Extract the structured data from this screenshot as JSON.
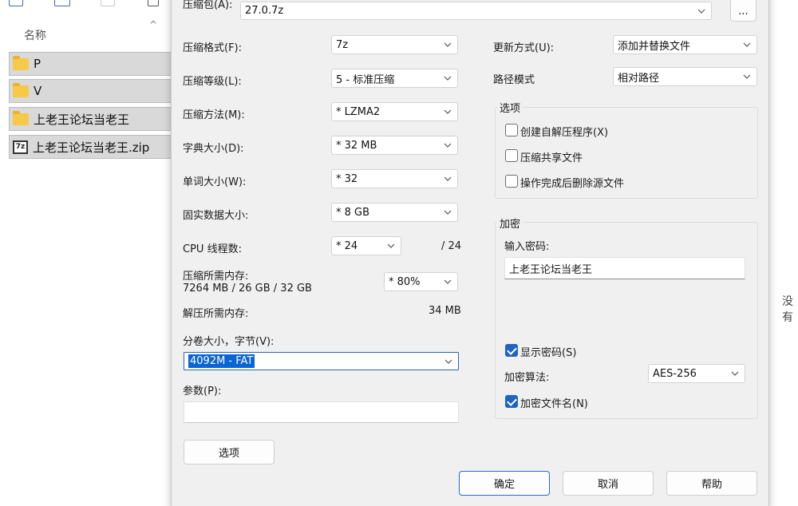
{
  "explorer": {
    "column_header": "名称",
    "items": [
      {
        "name": "P",
        "icon": "folder-icon"
      },
      {
        "name": "V",
        "icon": "folder-icon"
      },
      {
        "name": "上老王论坛当老王",
        "icon": "folder-icon"
      },
      {
        "name": "上老王论坛当老王.zip",
        "icon": "7z-archive-icon"
      }
    ],
    "right_text": "没有"
  },
  "dialog": {
    "archive_label": "压缩包(A):",
    "archive_value": "27.0.7z",
    "browse_label": "...",
    "format_label": "压缩格式(F):",
    "format_value": "7z",
    "level_label": "压缩等级(L):",
    "level_value": "5 - 标准压缩",
    "method_label": "压缩方法(M):",
    "method_value": "* LZMA2",
    "dict_label": "字典大小(D):",
    "dict_value": "* 32 MB",
    "word_label": "单词大小(W):",
    "word_value": "* 32",
    "solid_label": "固实数据大小:",
    "solid_value": "* 8 GB",
    "threads_label": "CPU 线程数:",
    "threads_value": "* 24",
    "threads_max": "/ 24",
    "mem_label": "压缩所需内存:",
    "mem_detail": "7264 MB / 26 GB / 32 GB",
    "mem_value": "* 80%",
    "decomp_label": "解压所需内存:",
    "decomp_value": "34 MB",
    "volume_label": "分卷大小，字节(V):",
    "volume_value": "4092M - FAT",
    "params_label": "参数(P):",
    "params_value": "",
    "options_button": "选项",
    "update_label": "更新方式(U):",
    "update_value": "添加并替换文件",
    "path_label": "路径模式",
    "path_value": "相对路径",
    "options_group": "选项",
    "opt_sfx": "创建自解压程序(X)",
    "opt_shared": "压缩共享文件",
    "opt_delete": "操作完成后删除源文件",
    "encrypt_group": "加密",
    "password_label": "输入密码:",
    "password_value": "上老王论坛当老王",
    "show_password": "显示密码(S)",
    "enc_method_label": "加密算法:",
    "enc_method_value": "AES-256",
    "encrypt_names": "加密文件名(N)",
    "ok": "确定",
    "cancel": "取消",
    "help": "帮助"
  },
  "colors": {
    "accent": "#1f64c0",
    "selection": "#0a64d2",
    "folder": "#f7c948"
  }
}
